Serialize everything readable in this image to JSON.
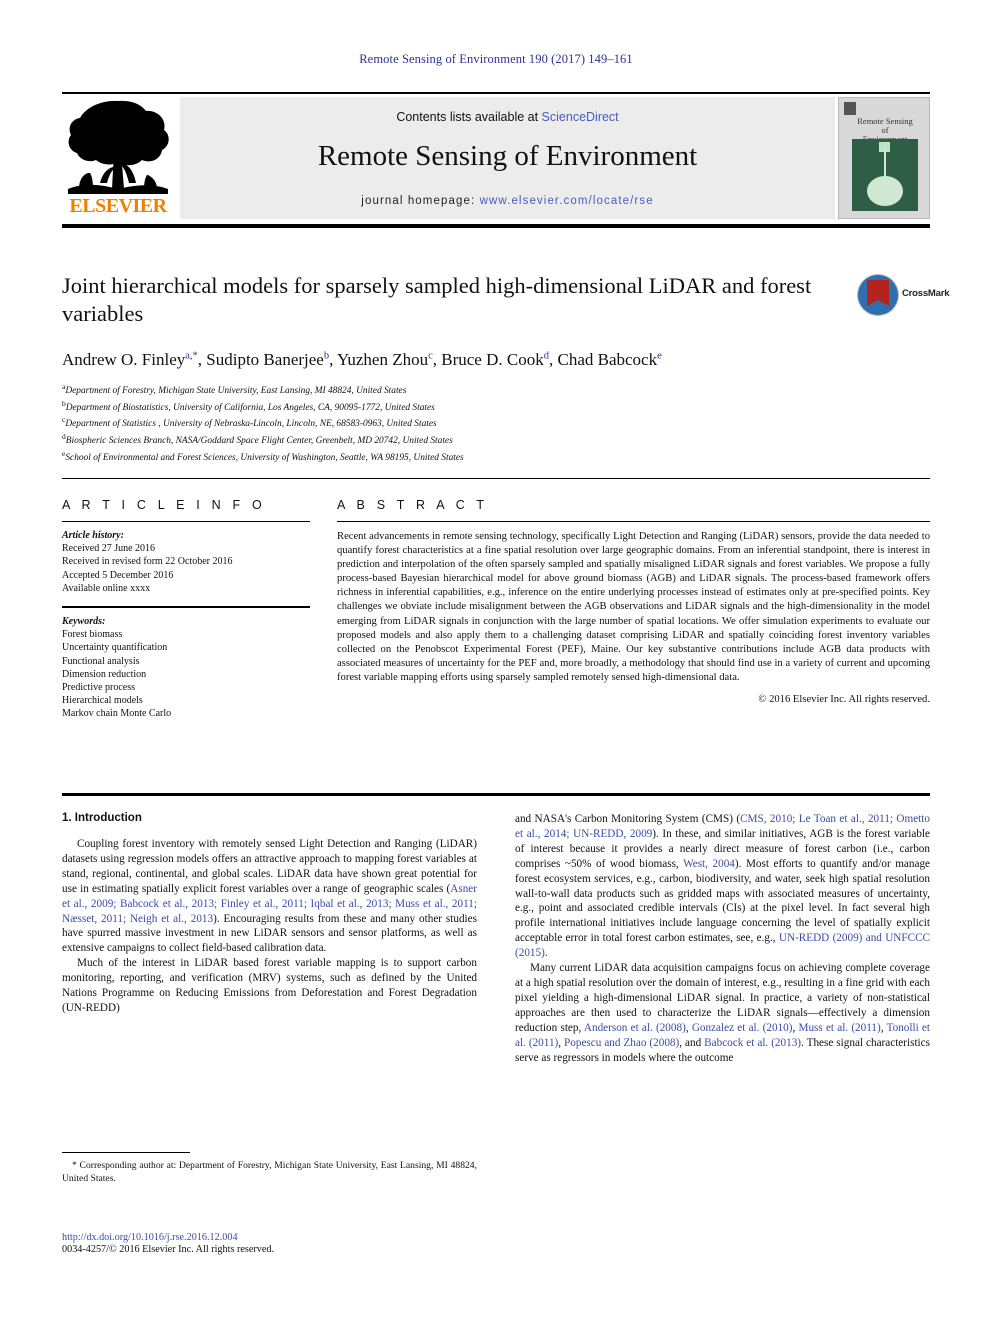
{
  "running_head": "Remote Sensing of Environment 190 (2017) 149–161",
  "masthead": {
    "publisher_wordmark": "ELSEVIER",
    "contents_prefix": "Contents lists available at ",
    "contents_link": "ScienceDirect",
    "journal_title": "Remote Sensing of Environment",
    "homepage_prefix": "journal homepage: ",
    "homepage_url": "www.elsevier.com/locate/rse",
    "cover_title_line1": "Remote Sensing",
    "cover_title_line2": "of",
    "cover_title_line3": "Environment"
  },
  "article": {
    "title": "Joint hierarchical models for sparsely sampled high-dimensional LiDAR and forest variables",
    "crossmark_label": "CrossMark",
    "authors_html": "Andrew O. Finley<sup>a,*</sup>, Sudipto Banerjee<sup>b</sup>, Yuzhen Zhou<sup>c</sup>, Bruce D. Cook<sup>d</sup>, Chad Babcock<sup>e</sup>",
    "affiliations": [
      {
        "marker": "a",
        "text": "Department of Forestry, Michigan State University, East Lansing, MI 48824, United States"
      },
      {
        "marker": "b",
        "text": "Department of Biostatistics, University of California, Los Angeles, CA, 90095-1772, United States"
      },
      {
        "marker": "c",
        "text": "Department of Statistics , University of Nebraska-Lincoln, Lincoln, NE, 68583-0963, United States"
      },
      {
        "marker": "d",
        "text": "Biospheric Sciences Branch, NASA/Goddard Space Flight Center, Greenbelt, MD 20742, United States"
      },
      {
        "marker": "e",
        "text": "School of Environmental and Forest Sciences, University of Washington, Seattle, WA 98195, United States"
      }
    ]
  },
  "article_info": {
    "heading": "A R T I C L E   I N F O",
    "history_label": "Article history:",
    "history": [
      "Received 27 June 2016",
      "Received in revised form 22 October 2016",
      "Accepted 5 December 2016",
      "Available online xxxx"
    ],
    "keywords_label": "Keywords:",
    "keywords": [
      "Forest biomass",
      "Uncertainty quantification",
      "Functional analysis",
      "Dimension reduction",
      "Predictive process",
      "Hierarchical models",
      "Markov chain Monte Carlo"
    ]
  },
  "abstract": {
    "heading": "A B S T R A C T",
    "text": "Recent advancements in remote sensing technology, specifically Light Detection and Ranging (LiDAR) sensors, provide the data needed to quantify forest characteristics at a fine spatial resolution over large geographic domains. From an inferential standpoint, there is interest in prediction and interpolation of the often sparsely sampled and spatially misaligned LiDAR signals and forest variables. We propose a fully process-based Bayesian hierarchical model for above ground biomass (AGB) and LiDAR signals. The process-based framework offers richness in inferential capabilities, e.g., inference on the entire underlying processes instead of estimates only at pre-specified points. Key challenges we obviate include misalignment between the AGB observations and LiDAR signals and the high-dimensionality in the model emerging from LiDAR signals in conjunction with the large number of spatial locations. We offer simulation experiments to evaluate our proposed models and also apply them to a challenging dataset comprising LiDAR and spatially coinciding forest inventory variables collected on the Penobscot Experimental Forest (PEF), Maine. Our key substantive contributions include AGB data products with associated measures of uncertainty for the PEF and, more broadly, a methodology that should find use in a variety of current and upcoming forest variable mapping efforts using sparsely sampled remotely sensed high-dimensional data.",
    "copyright": "© 2016 Elsevier Inc. All rights reserved."
  },
  "body": {
    "section_heading": "1. Introduction",
    "left_paragraph_1_html": "Coupling forest inventory with remotely sensed Light Detection and Ranging (LiDAR) datasets using regression models offers an attractive approach to mapping forest variables at stand, regional, continental, and global scales. LiDAR data have shown great potential for use in estimating spatially explicit forest variables over a range of geographic scales (<span class=\"cit\">Asner et al., 2009; Babcock et al., 2013; Finley et al., 2011; Iqbal et al., 2013; Muss et al., 2011; Næsset, 2011; Neigh et al., 2013</span>). Encouraging results from these and many other studies have spurred massive investment in new LiDAR sensors and sensor platforms, as well as extensive campaigns to collect field-based calibration data.",
    "left_paragraph_2_html": "Much of the interest in LiDAR based forest variable mapping is to support carbon monitoring, reporting, and verification (MRV) systems, such as defined by the United Nations Programme on Reducing Emissions from Deforestation and Forest Degradation (UN-REDD)",
    "right_paragraph_1_html": "and NASA's Carbon Monitoring System (CMS) (<span class=\"cit\">CMS, 2010; Le Toan et al., 2011; Ometto et al., 2014; UN-REDD, 2009</span>). In these, and similar initiatives, AGB is the forest variable of interest because it provides a nearly direct measure of forest carbon (i.e., carbon comprises ~50% of wood biomass, <span class=\"cit\">West, 2004</span>). Most efforts to quantify and/or manage forest ecosystem services, e.g., carbon, biodiversity, and water, seek high spatial resolution wall-to-wall data products such as gridded maps with associated measures of uncertainty, e.g., point and associated credible intervals (CIs) at the pixel level. In fact several high profile international initiatives include language concerning the level of spatially explicit acceptable error in total forest carbon estimates, see, e.g., <span class=\"cit\">UN-REDD (2009) and UNFCCC (2015)</span>.",
    "right_paragraph_2_html": "Many current LiDAR data acquisition campaigns focus on achieving complete coverage at a high spatial resolution over the domain of interest, e.g., resulting in a fine grid with each pixel yielding a high-dimensional LiDAR signal. In practice, a variety of non-statistical approaches are then used to characterize the LiDAR signals—effectively a dimension reduction step, <span class=\"cit\">Anderson et al. (2008)</span>, <span class=\"cit\">Gonzalez et al. (2010)</span>, <span class=\"cit\">Muss et al. (2011)</span>, <span class=\"cit\">Tonolli et al. (2011)</span>, <span class=\"cit\">Popescu and Zhao (2008)</span>, and <span class=\"cit\">Babcock et al. (2013)</span>. These signal characteristics serve as regressors in models where the outcome"
  },
  "footnote": {
    "text": "* Corresponding author at: Department of Forestry, Michigan State University, East Lansing, MI 48824, United States."
  },
  "footer": {
    "doi": "http://dx.doi.org/10.1016/j.rse.2016.12.004",
    "issn_line": "0034-4257/© 2016 Elsevier Inc. All rights reserved."
  },
  "colors": {
    "link": "#3b4ba8",
    "running_head": "#2e3191",
    "elsevier_orange": "#f08000",
    "cover_green": "#2f5e46",
    "crossmark_blue": "#2f6fb0",
    "crossmark_red": "#b3241f"
  }
}
